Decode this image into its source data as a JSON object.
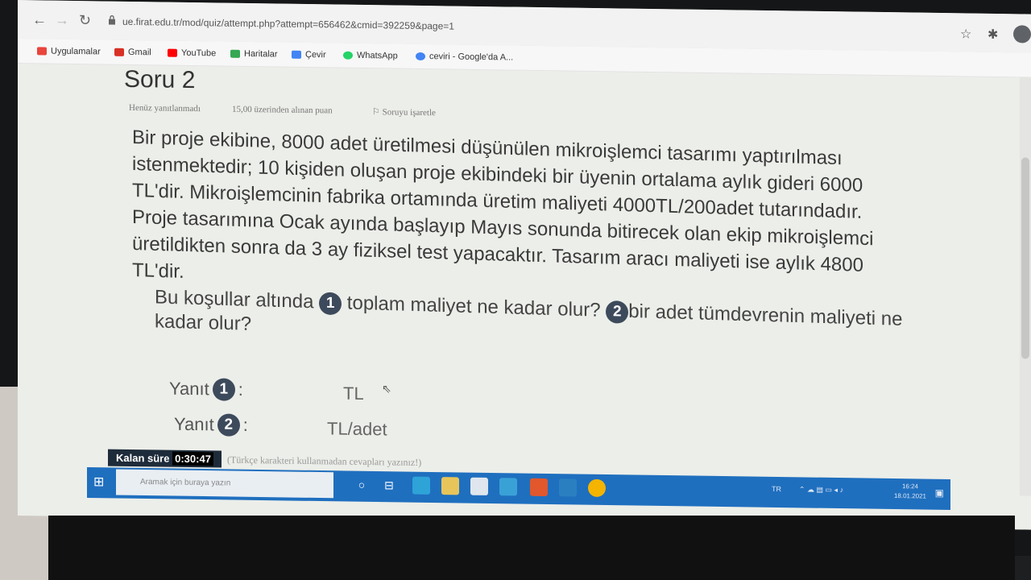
{
  "browser": {
    "url": "ue.firat.edu.tr/mod/quiz/attempt.php?attempt=656462&cmid=392259&page=1",
    "bookmarks": [
      {
        "label": "Uygulamalar",
        "icon": "apps-icon",
        "color": "#e8453c"
      },
      {
        "label": "Gmail",
        "icon": "gmail-icon",
        "color": "#d93025"
      },
      {
        "label": "YouTube",
        "icon": "youtube-icon",
        "color": "#ff0000"
      },
      {
        "label": "Haritalar",
        "icon": "maps-icon",
        "color": "#34a853"
      },
      {
        "label": "Çevir",
        "icon": "translate-icon",
        "color": "#4285f4"
      },
      {
        "label": "WhatsApp",
        "icon": "whatsapp-icon",
        "color": "#25d366"
      },
      {
        "label": "ceviri - Google'da A...",
        "icon": "google-icon",
        "color": "#4285f4"
      }
    ]
  },
  "quiz": {
    "title": "Soru 2",
    "status": "Henüz yanıtlanmadı",
    "points": "15,00 üzerinden alınan puan",
    "flag_label": "Soruyu işaretle",
    "question_text": "Bir proje ekibine, 8000 adet üretilmesi düşünülen mikroişlemci tasarımı yaptırılması istenmektedir; 10 kişiden oluşan proje ekibindeki bir üyenin ortalama aylık gideri 6000 TL'dir. Mikroişlemcinin fabrika ortamında üretim maliyeti 4000TL/200adet tutarındadır. Proje tasarımına Ocak ayında başlayıp Mayıs sonunda bitirecek olan ekip mikroişlemci üretildikten sonra da 3 ay fiziksel test yapacaktır. Tasarım aracı maliyeti ise aylık 4800 TL'dir.",
    "sub_q_prefix": "Bu koşullar altında",
    "num1": "1",
    "sub_q1": "toplam maliyet ne kadar olur?",
    "num2": "2",
    "sub_q2": "bir adet tümdevrenin maliyeti ne kadar olur?",
    "answer_label": "Yanıt",
    "answer_colon": ":",
    "answer1_unit": "TL",
    "answer2_unit": "TL/adet",
    "hint": "(Türkçe karakteri kullanmadan cevapları yazınız!)",
    "timer_label": "Kalan süre",
    "timer_value": "0:30:47"
  },
  "taskbar": {
    "search_placeholder": "Aramak için buraya yazın",
    "lang": "TR",
    "time": "16:24",
    "date": "18.01.2021"
  }
}
